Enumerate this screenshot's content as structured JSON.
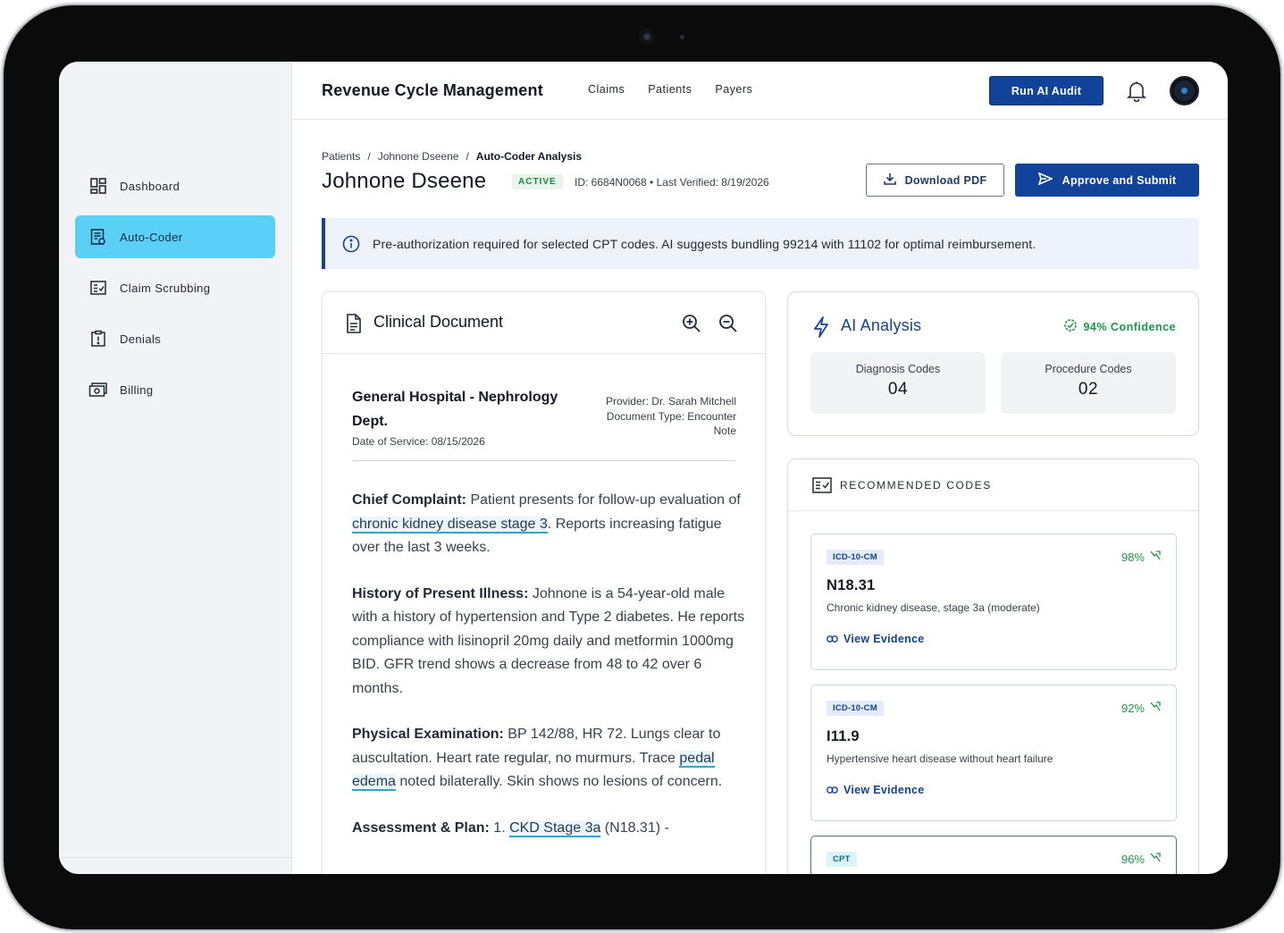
{
  "header": {
    "title": "Revenue Cycle Management",
    "nav": [
      "Claims",
      "Patients",
      "Payers"
    ],
    "run_audit_label": "Run AI Audit"
  },
  "sidebar": {
    "items": [
      {
        "label": "Dashboard",
        "icon": "dashboard-icon"
      },
      {
        "label": "Auto-Coder",
        "icon": "auto-coder-icon",
        "active": true
      },
      {
        "label": "Claim Scrubbing",
        "icon": "claim-scrubbing-icon"
      },
      {
        "label": "Denials",
        "icon": "denials-icon"
      },
      {
        "label": "Billing",
        "icon": "billing-icon"
      }
    ]
  },
  "breadcrumb": {
    "items": [
      "Patients",
      "/",
      "Johnone Dseene",
      "/",
      "Auto-Coder Analysis"
    ]
  },
  "patient": {
    "name": "Johnone Dseene",
    "status": "ACTIVE",
    "meta": "ID: 6684N0068 • Last Verified: 8/19/2026"
  },
  "actions": {
    "download_label": "Download PDF",
    "approve_label": "Approve and Submit"
  },
  "alert": {
    "text": "Pre-authorization required for selected CPT codes. AI suggests bundling 99214 with 11102 for optimal reimbursement."
  },
  "document": {
    "title": "Clinical Document",
    "hospital": "General Hospital - Nephrology Dept.",
    "date_of_service": "Date of Service: 08/15/2026",
    "provider": "Provider: Dr. Sarah Mitchell",
    "document_type": "Document Type: Encounter Note",
    "sections": {
      "chief_complaint_label": "Chief Complaint:",
      "chief_complaint_a": " Patient presents for follow-up evaluation of ",
      "chief_complaint_hl": "chronic kidney disease stage 3",
      "chief_complaint_b": ". Reports increasing fatigue over the last 3 weeks.",
      "hpi_label": "History of Present Illness:",
      "hpi_text": " Johnone is a 54-year-old male with a history of hypertension and Type 2 diabetes. He reports compliance with lisinopril 20mg daily and metformin 1000mg BID. GFR trend shows a decrease from 48 to 42 over 6 months.",
      "exam_label": "Physical Examination:",
      "exam_a": " BP 142/88, HR 72. Lungs clear to auscultation. Heart rate regular, no murmurs. Trace ",
      "exam_hl": "pedal edema",
      "exam_b": " noted bilaterally. Skin shows no lesions of concern.",
      "plan_label": "Assessment & Plan:",
      "plan_a": " 1. ",
      "plan_hl": "CKD Stage 3a",
      "plan_b": " (N18.31) -"
    }
  },
  "analysis": {
    "title": "AI Analysis",
    "confidence": "94% Confidence",
    "diagnosis_label": "Diagnosis Codes",
    "diagnosis_value": "04",
    "procedure_label": "Procedure Codes",
    "procedure_value": "02"
  },
  "recommended": {
    "title": "RECOMMENDED CODES",
    "codes": [
      {
        "type": "ICD-10-CM",
        "pct": "98%",
        "code": "N18.31",
        "desc": "Chronic kidney disease, stage 3a (moderate)",
        "evidence": "View Evidence"
      },
      {
        "type": "ICD-10-CM",
        "pct": "92%",
        "code": "I11.9",
        "desc": "Hypertensive heart disease without heart failure",
        "evidence": "View Evidence"
      },
      {
        "type": "CPT",
        "pct": "96%"
      }
    ]
  },
  "colors": {
    "primary": "#11439a",
    "active_nav": "#5bd0f6",
    "success": "#1a9a45",
    "highlight_underline": "#2fa6c9"
  }
}
